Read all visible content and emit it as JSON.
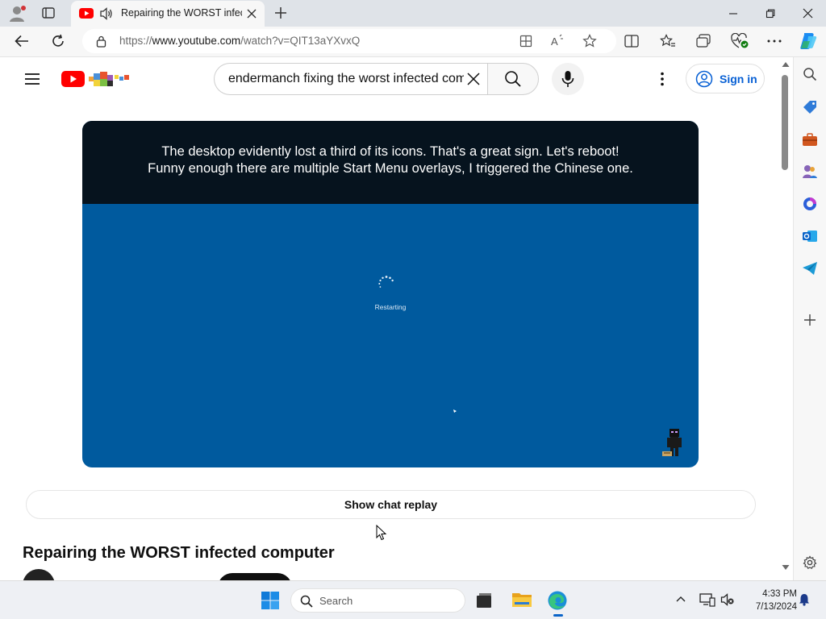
{
  "browser": {
    "tab": {
      "title": "Repairing the WORST infecte"
    },
    "address": {
      "prefix": "https://",
      "domain": "www.youtube.com",
      "path": "/watch?v=QIT13aYXvxQ"
    }
  },
  "youtube": {
    "search": {
      "query": "endermanch fixing the worst infected com"
    },
    "signin_label": "Sign in",
    "video": {
      "caption_line1": "The desktop evidently lost a third of its icons. That's a great sign. Let's reboot!",
      "caption_line2": "Funny enough there are multiple Start Menu overlays, I triggered the Chinese one.",
      "restart_text": "Restarting"
    },
    "chat_button_label": "Show chat replay",
    "video_title": "Repairing the WORST infected computer"
  },
  "taskbar": {
    "search_label": "Search",
    "time": "4:33 PM",
    "date": "7/13/2024"
  },
  "colors": {
    "youtube_red": "#ff0000",
    "link_blue": "#065fd4",
    "restart_blue": "#005a9e",
    "caption_bg": "#06131e"
  }
}
